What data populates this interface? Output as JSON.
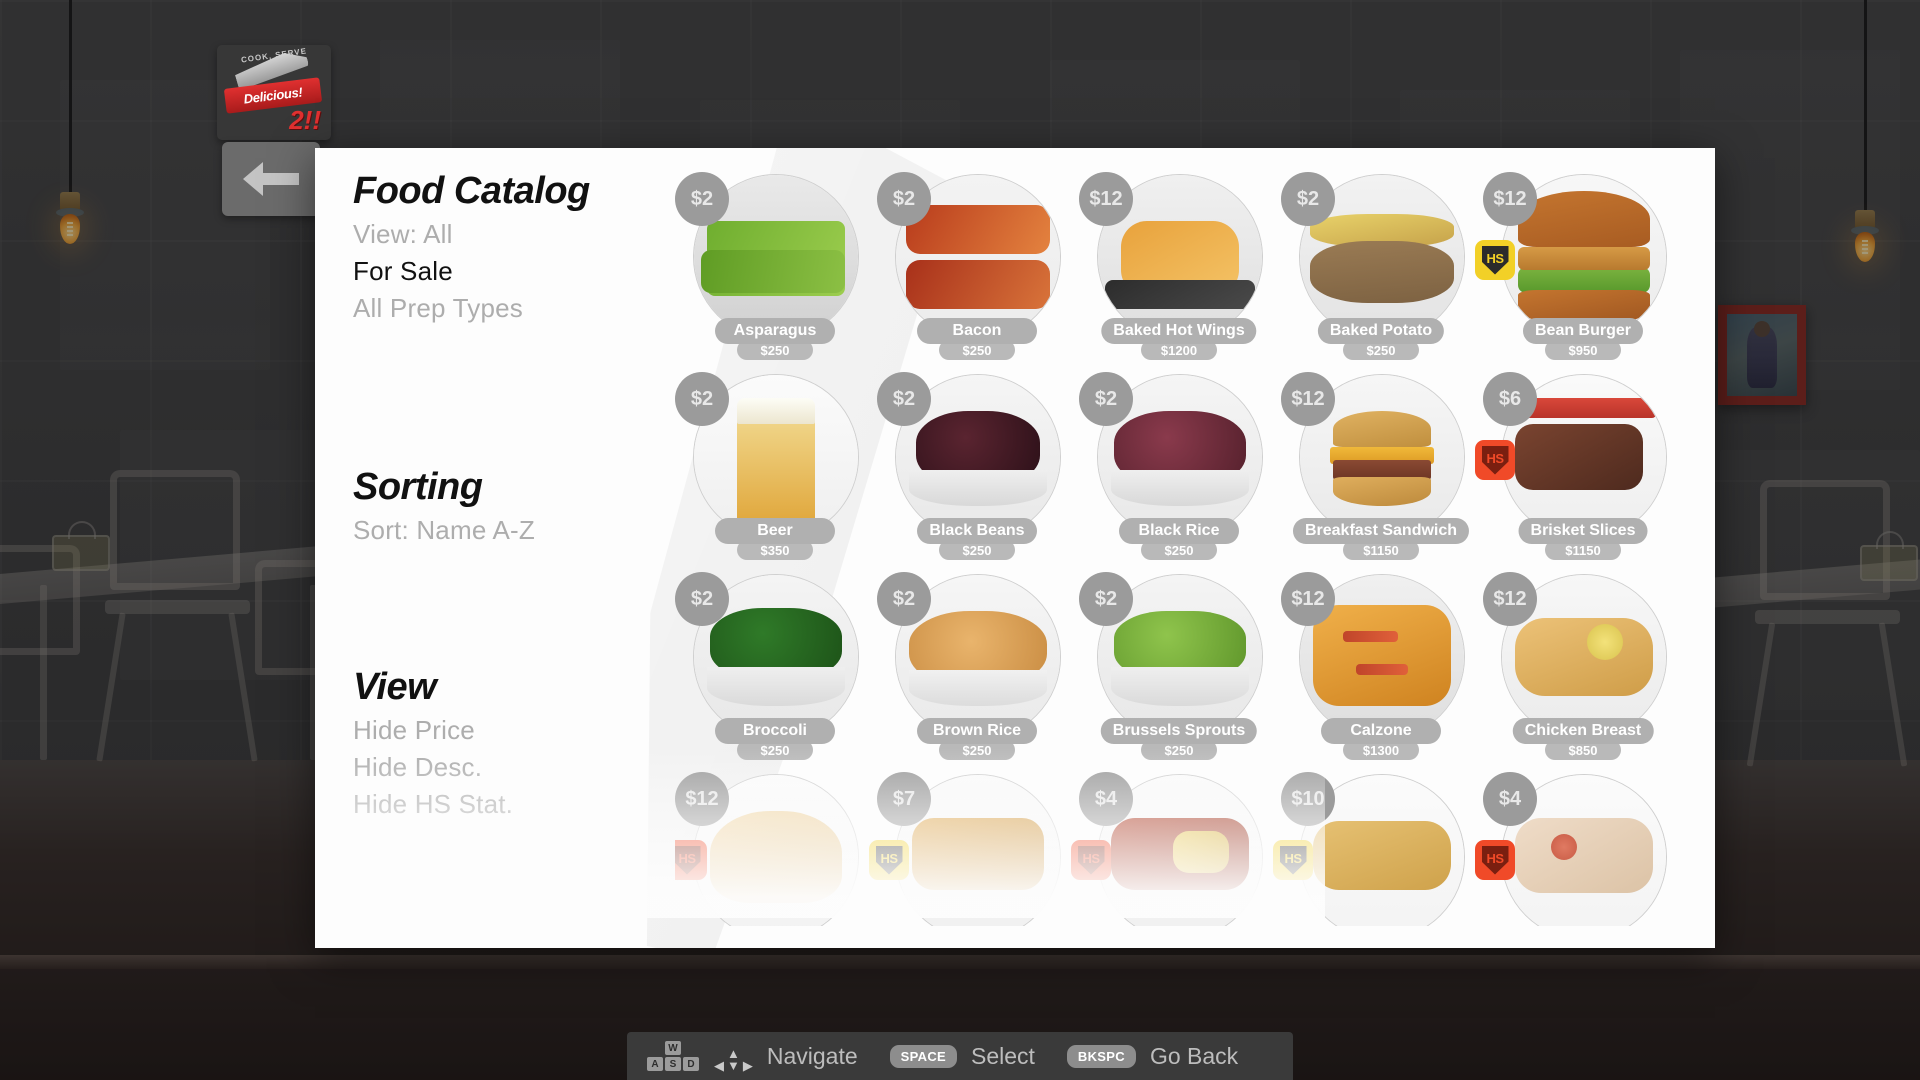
{
  "window": {
    "game_logo_top": "COOK, SERVE",
    "game_logo_main": "Delicious!",
    "game_logo_suffix": "2!!"
  },
  "sidebar": {
    "title": "Food Catalog",
    "filters": [
      {
        "label": "View: All",
        "active": false
      },
      {
        "label": "For Sale",
        "active": true
      },
      {
        "label": "All Prep Types",
        "active": false
      }
    ],
    "sorting_header": "Sorting",
    "sorting_options": [
      {
        "label": "Sort: Name A-Z",
        "active": false
      }
    ],
    "view_header": "View",
    "view_options": [
      {
        "label": "Hide Price",
        "active": false
      },
      {
        "label": "Hide Desc.",
        "active": false
      },
      {
        "label": "Hide HS Stat.",
        "active": false
      }
    ]
  },
  "catalog": {
    "rows": [
      [
        {
          "name": "Asparagus",
          "price": "$2",
          "sub": "$250",
          "hs": null,
          "food": "asparagus"
        },
        {
          "name": "Bacon",
          "price": "$2",
          "sub": "$250",
          "hs": null,
          "food": "bacon"
        },
        {
          "name": "Baked Hot Wings",
          "price": "$12",
          "sub": "$1200",
          "hs": null,
          "food": "hotwings"
        },
        {
          "name": "Baked Potato",
          "price": "$2",
          "sub": "$250",
          "hs": null,
          "food": "potato"
        },
        {
          "name": "Bean Burger",
          "price": "$12",
          "sub": "$950",
          "hs": "yellow",
          "food": "burger"
        }
      ],
      [
        {
          "name": "Beer",
          "price": "$2",
          "sub": "$350",
          "hs": null,
          "food": "beer"
        },
        {
          "name": "Black Beans",
          "price": "$2",
          "sub": "$250",
          "hs": null,
          "food": "blackbeans"
        },
        {
          "name": "Black Rice",
          "price": "$2",
          "sub": "$250",
          "hs": null,
          "food": "blackrice"
        },
        {
          "name": "Breakfast Sandwich",
          "price": "$12",
          "sub": "$1150",
          "hs": null,
          "food": "bsandwich"
        },
        {
          "name": "Brisket Slices",
          "price": "$6",
          "sub": "$1150",
          "hs": "red",
          "food": "brisket"
        }
      ],
      [
        {
          "name": "Broccoli",
          "price": "$2",
          "sub": "$250",
          "hs": null,
          "food": "broccoli"
        },
        {
          "name": "Brown Rice",
          "price": "$2",
          "sub": "$250",
          "hs": null,
          "food": "brownrice"
        },
        {
          "name": "Brussels Sprouts",
          "price": "$2",
          "sub": "$250",
          "hs": null,
          "food": "sprouts"
        },
        {
          "name": "Calzone",
          "price": "$12",
          "sub": "$1300",
          "hs": null,
          "food": "calzone"
        },
        {
          "name": "Chicken Breast",
          "price": "$12",
          "sub": "$850",
          "hs": null,
          "food": "chicken"
        }
      ],
      [
        {
          "name": "",
          "price": "$12",
          "sub": "",
          "hs": "red",
          "food": "bun"
        },
        {
          "name": "",
          "price": "$7",
          "sub": "",
          "hs": "yellow",
          "food": "friedchicken"
        },
        {
          "name": "",
          "price": "$4",
          "sub": "",
          "hs": "red",
          "food": "chili"
        },
        {
          "name": "",
          "price": "$10",
          "sub": "",
          "hs": "yellow",
          "food": "gravy"
        },
        {
          "name": "",
          "price": "$4",
          "sub": "",
          "hs": "red",
          "food": "salad"
        }
      ]
    ]
  },
  "controls": {
    "navigate_label": "Navigate",
    "select_key": "SPACE",
    "select_label": "Select",
    "back_key": "BKSPC",
    "back_label": "Go Back",
    "wasd": {
      "up": "W",
      "left": "A",
      "down": "S",
      "right": "D"
    }
  },
  "colors": {
    "panel_bg": "#fdfdfd",
    "badge_gray": "#9b9b9b",
    "pill_gray": "#b0b0b0",
    "hs_yellow": "#f2d027",
    "hs_red": "#f04a28",
    "text_muted": "#adadad",
    "text_active": "#111111"
  }
}
